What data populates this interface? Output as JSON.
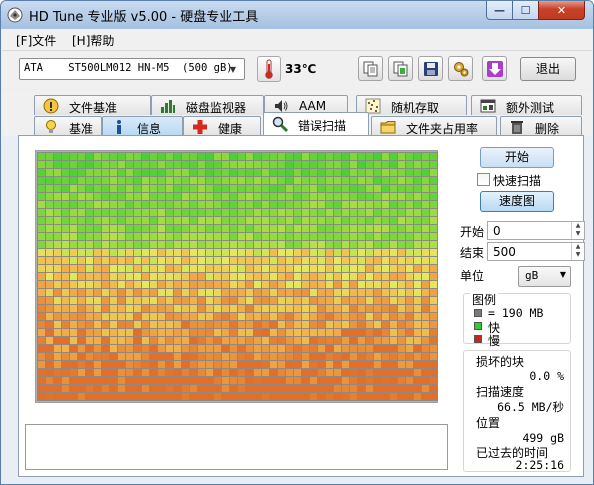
{
  "window": {
    "title": "HD Tune 专业版 v5.00 - 硬盘专业工具",
    "min_glyph": "—",
    "max_glyph": "☐",
    "close_glyph": "✕"
  },
  "menu": {
    "file": "[F]文件",
    "help": "[H]帮助"
  },
  "toolbar": {
    "drive": "ATA    ST500LM012 HN-M5  (500 gB)",
    "temperature": "33℃",
    "icons": [
      "copy-text-icon",
      "copy-screenshot-icon",
      "save-icon",
      "options-icon",
      "download-icon"
    ],
    "exit_label": "退出"
  },
  "tabs": {
    "row1": [
      {
        "label": "文件基准",
        "icon": "file-benchmark-icon"
      },
      {
        "label": "磁盘监视器",
        "icon": "disk-monitor-icon"
      },
      {
        "label": "AAM",
        "icon": "speaker-icon"
      },
      {
        "label": "随机存取",
        "icon": "random-access-icon"
      },
      {
        "label": "额外测试",
        "icon": "extra-tests-icon"
      }
    ],
    "row2": [
      {
        "label": "基准",
        "icon": "benchmark-icon"
      },
      {
        "label": "信息",
        "icon": "info-icon"
      },
      {
        "label": "健康",
        "icon": "health-icon"
      },
      {
        "label": "错误扫描",
        "icon": "magnifier-icon",
        "active": true
      },
      {
        "label": "文件夹占用率",
        "icon": "folder-icon"
      },
      {
        "label": "删除",
        "icon": "trash-icon"
      }
    ]
  },
  "scan": {
    "start_label": "开始",
    "quick_scan_label": "快速扫描",
    "quick_scan_checked": false,
    "speed_map_label": "速度图",
    "start_field_label": "开始",
    "start_value": "0",
    "end_field_label": "结束",
    "end_value": "500",
    "unit_label": "单位",
    "unit_value": "gB"
  },
  "legend": {
    "title": "图例",
    "block_size": "= 190 MB",
    "fast_label": "快",
    "slow_label": "慢"
  },
  "colors": {
    "block_gray": "#7a7a7a",
    "fast": "#2ecc2e",
    "slow": "#c8261a",
    "grid_line": "#8a8a8a"
  },
  "stats": {
    "damaged_label": "损坏的块",
    "damaged_value": "0.0 %",
    "speed_label": "扫描速度",
    "speed_value": "66.5 MB/秒",
    "position_label": "位置",
    "position_value": "499 gB",
    "elapsed_label": "已过去的时间",
    "elapsed_value": "2:25:16"
  }
}
